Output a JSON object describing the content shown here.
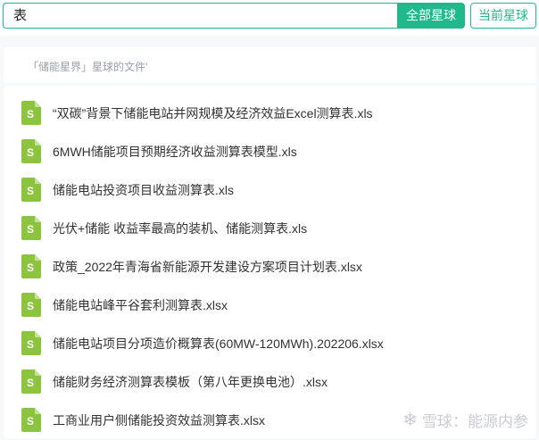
{
  "search": {
    "query": "表",
    "all_button": "全部星球",
    "current_button": "当前星球"
  },
  "section": {
    "title": "「储能星界」星球的文件'"
  },
  "files": [
    {
      "name": "“双碳”背景下储能电站并网规模及经济效益Excel测算表.xls",
      "icon": "spreadsheet-file-icon"
    },
    {
      "name": "6MWH储能项目预期经济收益测算表模型.xls",
      "icon": "spreadsheet-file-icon"
    },
    {
      "name": "储能电站投资项目收益测算表.xls",
      "icon": "spreadsheet-file-icon"
    },
    {
      "name": "光伏+储能 收益率最高的装机、储能测算表.xls",
      "icon": "spreadsheet-file-icon"
    },
    {
      "name": "政策_2022年青海省新能源开发建设方案项目计划表.xlsx",
      "icon": "spreadsheet-file-icon"
    },
    {
      "name": "储能电站峰平谷套利测算表.xlsx",
      "icon": "spreadsheet-file-icon"
    },
    {
      "name": "储能电站项目分项造价概算表(60MW-120MWh).202206.xlsx",
      "icon": "spreadsheet-file-icon"
    },
    {
      "name": "储能财务经济测算表模板（第八年更换电池）.xlsx",
      "icon": "spreadsheet-file-icon"
    },
    {
      "name": "工商业用户侧储能投资效益测算表.xlsx",
      "icon": "spreadsheet-file-icon"
    }
  ],
  "colors": {
    "accent": "#1fb98b",
    "file_icon": "#8cc43f"
  },
  "watermark": {
    "text": "雪球：能源内参",
    "icon": "snowball-logo-icon"
  }
}
